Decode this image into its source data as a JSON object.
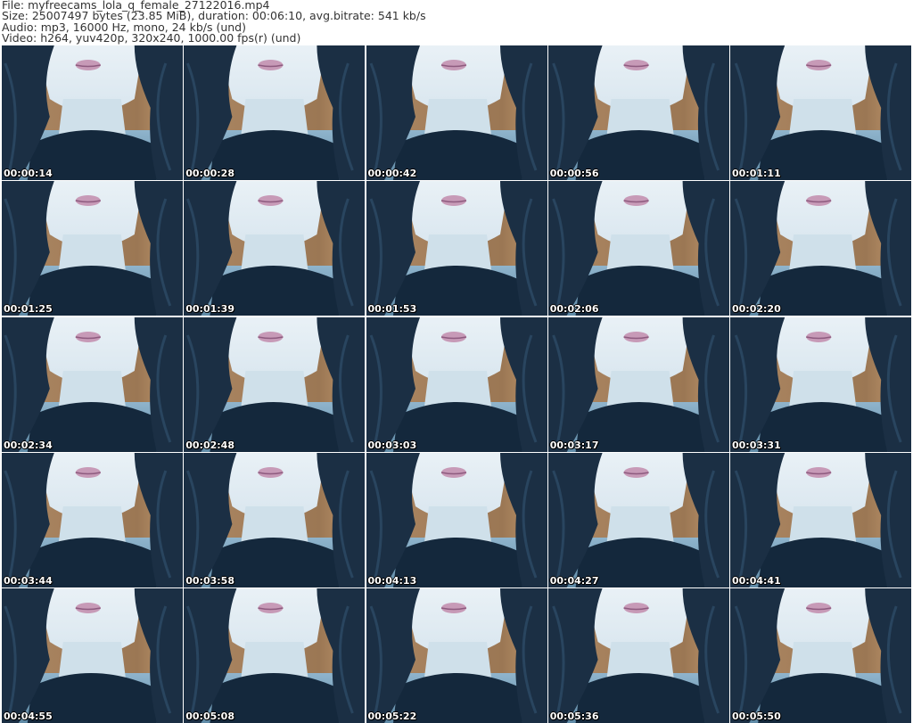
{
  "info": {
    "file": "File: myfreecams_lola_q_female_27122016.mp4",
    "size": "Size: 25007497 bytes (23.85 MiB), duration: 00:06:10, avg.bitrate: 541 kb/s",
    "audio": "Audio: mp3, 16000 Hz, mono, 24 kb/s (und)",
    "video": "Video: h264, yuv420p, 320x240, 1000.00 fps(r) (und)"
  },
  "thumbnails": [
    {
      "timestamp": "00:00:14"
    },
    {
      "timestamp": "00:00:28"
    },
    {
      "timestamp": "00:00:42"
    },
    {
      "timestamp": "00:00:56"
    },
    {
      "timestamp": "00:01:11"
    },
    {
      "timestamp": "00:01:25"
    },
    {
      "timestamp": "00:01:39"
    },
    {
      "timestamp": "00:01:53"
    },
    {
      "timestamp": "00:02:06"
    },
    {
      "timestamp": "00:02:20"
    },
    {
      "timestamp": "00:02:34"
    },
    {
      "timestamp": "00:02:48"
    },
    {
      "timestamp": "00:03:03"
    },
    {
      "timestamp": "00:03:17"
    },
    {
      "timestamp": "00:03:31"
    },
    {
      "timestamp": "00:03:44"
    },
    {
      "timestamp": "00:03:58"
    },
    {
      "timestamp": "00:04:13"
    },
    {
      "timestamp": "00:04:27"
    },
    {
      "timestamp": "00:04:41"
    },
    {
      "timestamp": "00:04:55"
    },
    {
      "timestamp": "00:05:08"
    },
    {
      "timestamp": "00:05:22"
    },
    {
      "timestamp": "00:05:36"
    },
    {
      "timestamp": "00:05:50"
    }
  ],
  "colors": {
    "background": "#ffffff",
    "header_text": "#333333",
    "timestamp_text": "#ffffff",
    "skin": "#d9e6ef",
    "hair": "#1b2f44",
    "lips": "#c79ab7",
    "wall": "#b98e62",
    "shirt": "#14283c"
  }
}
